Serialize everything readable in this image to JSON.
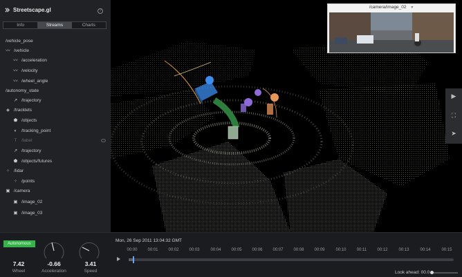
{
  "app": {
    "title": "Streetscape.gl",
    "help_icon": "help-circle-icon"
  },
  "tabs": [
    {
      "label": "Info",
      "active": false
    },
    {
      "label": "Streams",
      "active": true
    },
    {
      "label": "Charts",
      "active": false
    }
  ],
  "streams": [
    {
      "label": "/vehicle_pose",
      "icon": "",
      "dim": false
    },
    {
      "label": "/vehicle",
      "icon": "line-chart-icon",
      "dim": false
    },
    {
      "label": "/acceleration",
      "icon": "line-chart-icon",
      "dim": false
    },
    {
      "label": "/velocity",
      "icon": "line-chart-icon",
      "dim": false
    },
    {
      "label": "/wheel_angle",
      "icon": "line-chart-icon",
      "dim": false
    },
    {
      "label": "/autonomy_state",
      "icon": "",
      "dim": false
    },
    {
      "label": "/trajectory",
      "icon": "polyline-icon",
      "dim": false
    },
    {
      "label": "/tracklets",
      "icon": "cube-icon",
      "dim": false
    },
    {
      "label": "/objects",
      "icon": "polygon-icon",
      "dim": false
    },
    {
      "label": "/tracking_point",
      "icon": "circle-icon",
      "dim": false
    },
    {
      "label": "/label",
      "icon": "text-icon",
      "dim": true
    },
    {
      "label": "/trajectory",
      "icon": "polyline-icon",
      "dim": false
    },
    {
      "label": "/objects/futures",
      "icon": "polygon-icon",
      "dim": false
    },
    {
      "label": "/lidar",
      "icon": "points-icon",
      "dim": false
    },
    {
      "label": "/points",
      "icon": "points-icon",
      "dim": false
    },
    {
      "label": "/camera",
      "icon": "camera-icon",
      "dim": false
    },
    {
      "label": "/image_02",
      "icon": "camera-icon",
      "dim": false
    },
    {
      "label": "/image_03",
      "icon": "camera-icon",
      "dim": false
    }
  ],
  "meters": {
    "autonomy_badge": "Autonomous",
    "wheel": {
      "value": "7.42",
      "label": "Wheel"
    },
    "acceleration": {
      "value": "-0.66",
      "label": "Acceleration"
    },
    "speed": {
      "value": "3.41",
      "label": "Speed"
    }
  },
  "camera": {
    "title": "/camera/image_02",
    "caret_icon": "chevron-down-icon"
  },
  "side_toolbar": [
    "camera-icon",
    "fit-view-icon",
    "locate-arrow-icon"
  ],
  "timeline": {
    "date": "Mon, 26 Sep 2011 13:04:32 GMT",
    "ticks": [
      "00:00",
      "00:01",
      "00:02",
      "00:03",
      "00:04",
      "00:05",
      "00:06",
      "00:07",
      "00:08",
      "00:09",
      "00:10",
      "00:11",
      "00:12",
      "00:13",
      "00:14",
      "00:15"
    ],
    "progress": 0.012,
    "lookahead_label": "Look ahead: 00.0"
  },
  "colors": {
    "accent_green": "#36b24b",
    "track_blue": "#6ba3ff",
    "object_blue": "#3b8ef0",
    "object_purple": "#8e6bd8",
    "object_orange": "#e8955a",
    "path_green": "#2f7d3c",
    "lidar": "#9a9a8c"
  }
}
